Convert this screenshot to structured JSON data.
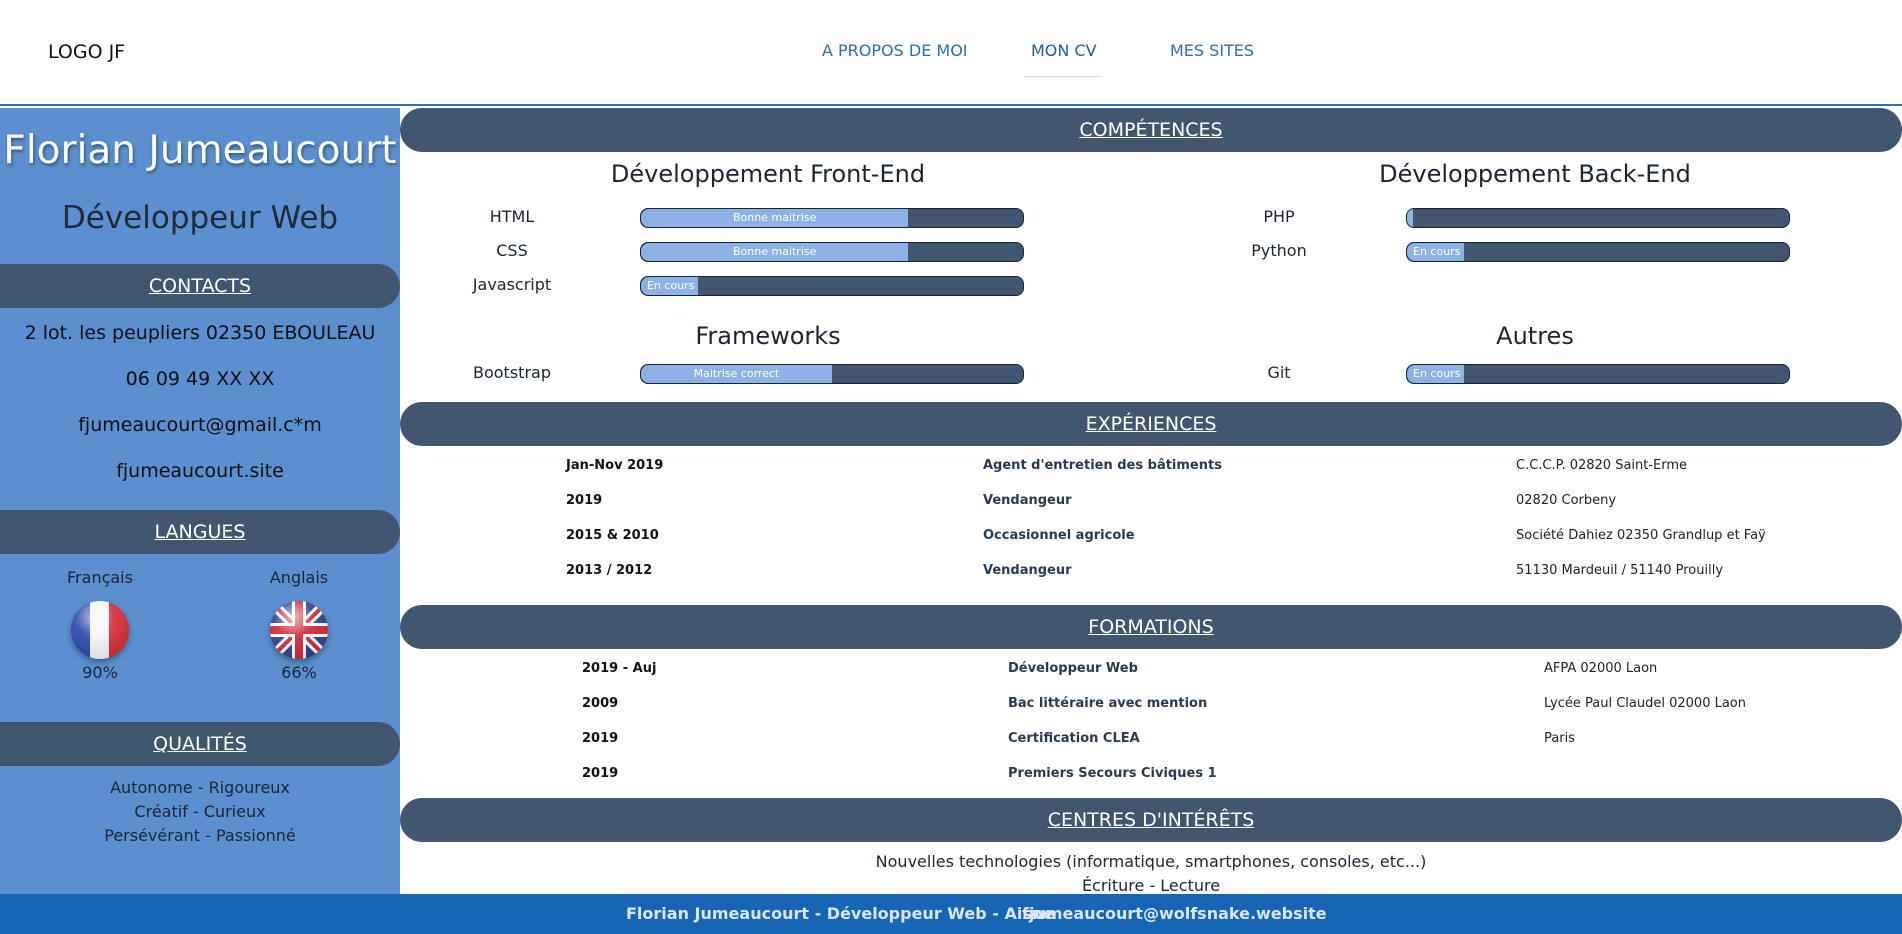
{
  "header": {
    "logo": "LOGO JF",
    "nav": [
      {
        "label": "A PROPOS DE MOI"
      },
      {
        "label": "MON CV"
      },
      {
        "label": "MES SITES"
      }
    ]
  },
  "sidebar": {
    "name": "Florian Jumeaucourt",
    "role": "Développeur Web",
    "contacts_title": "CONTACTS",
    "contacts": [
      "2 lot. les peupliers 02350 EBOULEAU",
      "06 09 49 XX XX",
      "fjumeaucourt@gmail.c*m",
      "fjumeaucourt.site"
    ],
    "langues_title": "LANGUES",
    "langues": [
      {
        "name": "Français",
        "percent": "90%",
        "flag": "france-flag-icon"
      },
      {
        "name": "Anglais",
        "percent": "66%",
        "flag": "uk-flag-icon"
      }
    ],
    "qualites_title": "QUALITÉS",
    "qualites": [
      "Autonome - Rigoureux",
      "Créatif - Curieux",
      "Persévérant - Passionné"
    ]
  },
  "competences": {
    "title": "COMPÉTENCES",
    "groups": [
      {
        "title": "Développement Front-End",
        "skills": [
          {
            "name": "HTML",
            "label": "Bonne maitrise",
            "level": 0.7
          },
          {
            "name": "CSS",
            "label": "Bonne maitrise",
            "level": 0.7
          },
          {
            "name": "Javascript",
            "label": "En cours",
            "level": 0.15
          }
        ]
      },
      {
        "title": "Développement Back-End",
        "skills": [
          {
            "name": "PHP",
            "label": "",
            "level": 0.01
          },
          {
            "name": "Python",
            "label": "En cours",
            "level": 0.15
          }
        ]
      },
      {
        "title": "Frameworks",
        "skills": [
          {
            "name": "Bootstrap",
            "label": "Maitrise correct",
            "level": 0.5
          }
        ]
      },
      {
        "title": "Autres",
        "skills": [
          {
            "name": "Git",
            "label": "En cours",
            "level": 0.15
          }
        ]
      }
    ]
  },
  "experiences": {
    "title": "EXPÉRIENCES",
    "rows": [
      {
        "date": "Jan-Nov 2019",
        "title": "Agent d'entretien des bâtiments",
        "place": "C.C.C.P. 02820 Saint-Erme"
      },
      {
        "date": "2019",
        "title": "Vendangeur",
        "place": "02820 Corbeny"
      },
      {
        "date": "2015 & 2010",
        "title": "Occasionnel agricole",
        "place": "Société Dahiez 02350 Grandlup et Faÿ"
      },
      {
        "date": "2013 / 2012",
        "title": "Vendangeur",
        "place": "51130 Mardeuil / 51140 Prouilly"
      }
    ]
  },
  "formations": {
    "title": "FORMATIONS",
    "rows": [
      {
        "date": "2019 - Auj",
        "title": "Développeur Web",
        "place": "AFPA 02000 Laon"
      },
      {
        "date": "2009",
        "title": "Bac littéraire avec mention",
        "place": "Lycée Paul Claudel 02000 Laon"
      },
      {
        "date": "2019",
        "title": "Certification CLEA",
        "place": "Paris"
      },
      {
        "date": "2019",
        "title": "Premiers Secours Civiques 1",
        "place": ""
      }
    ]
  },
  "interets": {
    "title": "CENTRES D'INTÉRÊTS",
    "items": [
      "Nouvelles technologies (informatique, smartphones, consoles, etc...)",
      "Écriture - Lecture"
    ]
  },
  "footer": {
    "left": "Florian Jumeaucourt - Développeur Web - Aisne",
    "right": "fjumeaucourt@wolfsnake.website"
  },
  "colors": {
    "sidebar_bg": "#5b8fcf",
    "section_bar": "#43566f",
    "bar_fill": "#8db2e6",
    "footer_bg": "#1766b6",
    "nav_link": "#2b6fb8"
  }
}
